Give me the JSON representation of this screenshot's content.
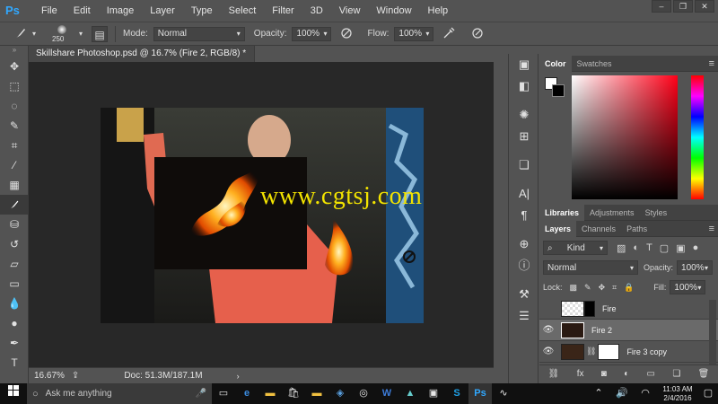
{
  "app": {
    "logo": "Ps"
  },
  "menu": [
    "File",
    "Edit",
    "Image",
    "Layer",
    "Type",
    "Select",
    "Filter",
    "3D",
    "View",
    "Window",
    "Help"
  ],
  "window_controls": [
    "–",
    "❐",
    "✕"
  ],
  "options": {
    "brush_size": "250",
    "mode_label": "Mode:",
    "mode_value": "Normal",
    "opacity_label": "Opacity:",
    "opacity_value": "100%",
    "flow_label": "Flow:",
    "flow_value": "100%"
  },
  "document": {
    "tab_title": "Skillshare Photoshop.psd @ 16.7% (Fire 2, RGB/8) *",
    "tab_close": "×",
    "zoom": "16.67%",
    "doc_info": "Doc: 51.3M/187.1M",
    "watermark": "www.cgtsj.com"
  },
  "color_panel": {
    "tabs": [
      "Color",
      "Swatches"
    ]
  },
  "libraries_panel": {
    "tabs": [
      "Libraries",
      "Adjustments",
      "Styles"
    ]
  },
  "layers_panel": {
    "tabs": [
      "Layers",
      "Channels",
      "Paths"
    ],
    "filter_label": "Kind",
    "blend_mode": "Normal",
    "opacity_label": "Opacity:",
    "opacity_value": "100%",
    "lock_label": "Lock:",
    "fill_label": "Fill:",
    "fill_value": "100%",
    "layers": [
      {
        "name": "Fire",
        "visible": false,
        "selected": false
      },
      {
        "name": "Fire 2",
        "visible": true,
        "selected": true
      },
      {
        "name": "Fire 3 copy",
        "visible": true,
        "selected": false
      }
    ]
  },
  "taskbar": {
    "search_placeholder": "Ask me anything",
    "time": "11:03 AM",
    "date": "2/4/2016"
  },
  "colors": {
    "accent": "#31a8ff",
    "panel": "#535353",
    "watermark": "#f2e300"
  }
}
